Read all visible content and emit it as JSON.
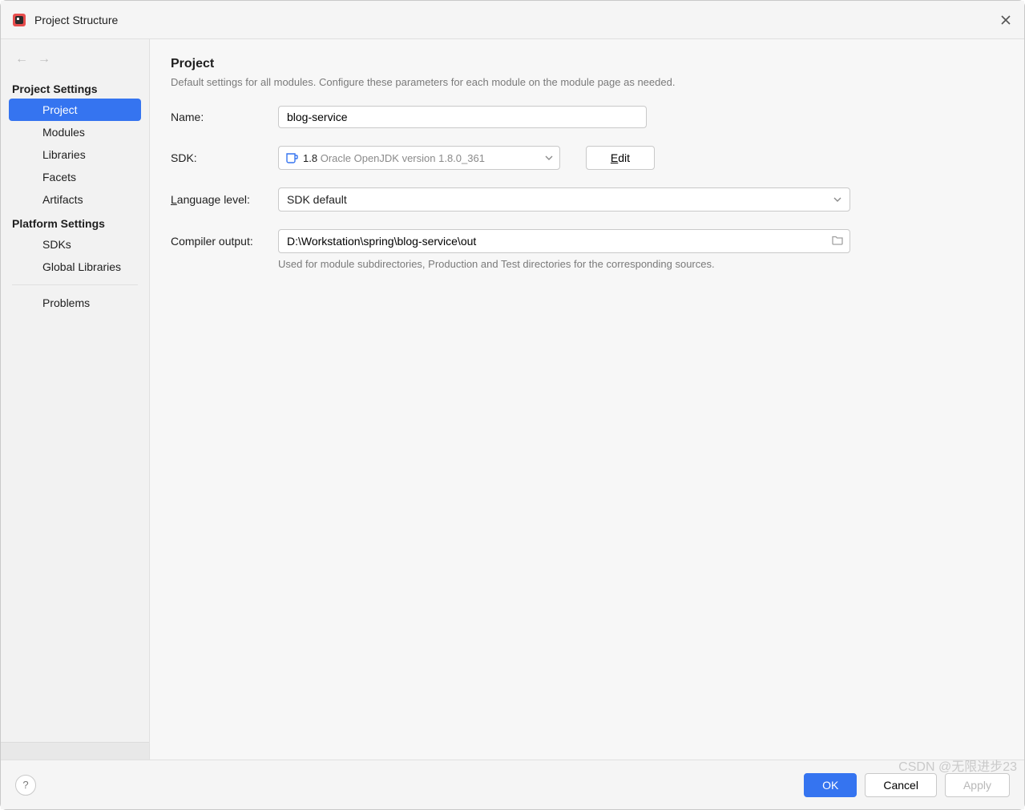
{
  "titlebar": {
    "title": "Project Structure"
  },
  "sidebar": {
    "heading_project_settings": "Project Settings",
    "heading_platform_settings": "Platform Settings",
    "items_project": [
      {
        "label": "Project",
        "selected": true
      },
      {
        "label": "Modules",
        "selected": false
      },
      {
        "label": "Libraries",
        "selected": false
      },
      {
        "label": "Facets",
        "selected": false
      },
      {
        "label": "Artifacts",
        "selected": false
      }
    ],
    "items_platform": [
      {
        "label": "SDKs"
      },
      {
        "label": "Global Libraries"
      }
    ],
    "item_problems": "Problems"
  },
  "content": {
    "heading": "Project",
    "description": "Default settings for all modules. Configure these parameters for each module on the module page as needed.",
    "name_label": "Name:",
    "name_value": "blog-service",
    "sdk_label": "SDK:",
    "sdk_value": "1.8",
    "sdk_detail": "Oracle OpenJDK version 1.8.0_361",
    "edit_button": "Edit",
    "lang_label_pre": "L",
    "lang_label_post": "anguage level:",
    "lang_value": "SDK default",
    "output_label": "Compiler output:",
    "output_value": "D:\\Workstation\\spring\\blog-service\\out",
    "output_hint": "Used for module subdirectories, Production and Test directories for the corresponding sources."
  },
  "footer": {
    "ok": "OK",
    "cancel": "Cancel",
    "apply": "Apply"
  },
  "watermark": "CSDN @无限进步23"
}
